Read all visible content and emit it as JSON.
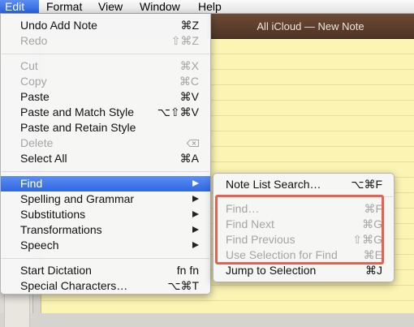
{
  "menubar": {
    "items": [
      {
        "label": "Edit",
        "active": true
      },
      {
        "label": "Format"
      },
      {
        "label": "View"
      },
      {
        "label": "Window"
      },
      {
        "label": "Help"
      }
    ]
  },
  "window": {
    "title": "All iCloud — New Note"
  },
  "edit_menu": {
    "items": [
      {
        "label": "Undo Add Note",
        "shortcut": "⌘Z"
      },
      {
        "label": "Redo",
        "shortcut": "⇧⌘Z",
        "disabled": true
      },
      {
        "label": "Cut",
        "shortcut": "⌘X",
        "disabled": true
      },
      {
        "label": "Copy",
        "shortcut": "⌘C",
        "disabled": true
      },
      {
        "label": "Paste",
        "shortcut": "⌘V"
      },
      {
        "label": "Paste and Match Style",
        "shortcut": "⌥⇧⌘V"
      },
      {
        "label": "Paste and Retain Style",
        "shortcut": ""
      },
      {
        "label": "Delete",
        "shortcut_icon": "delete-key-icon",
        "disabled": true
      },
      {
        "label": "Select All",
        "shortcut": "⌘A"
      },
      {
        "label": "Find",
        "submenu": true,
        "selected": true
      },
      {
        "label": "Spelling and Grammar",
        "submenu": true
      },
      {
        "label": "Substitutions",
        "submenu": true
      },
      {
        "label": "Transformations",
        "submenu": true
      },
      {
        "label": "Speech",
        "submenu": true
      },
      {
        "label": "Start Dictation",
        "shortcut": "fn fn"
      },
      {
        "label": "Special Characters…",
        "shortcut": "⌥⌘T"
      }
    ]
  },
  "find_menu": {
    "items": [
      {
        "label": "Note List Search…",
        "shortcut": "⌥⌘F"
      },
      {
        "label": "Find…",
        "shortcut": "⌘F",
        "disabled": true
      },
      {
        "label": "Find Next",
        "shortcut": "⌘G",
        "disabled": true
      },
      {
        "label": "Find Previous",
        "shortcut": "⇧⌘G",
        "disabled": true
      },
      {
        "label": "Use Selection for Find",
        "shortcut": "⌘E",
        "disabled": true
      },
      {
        "label": "Jump to Selection",
        "shortcut": "⌘J"
      }
    ]
  },
  "colors": {
    "selection": "#3a6ee8",
    "highlight_box": "#e8604f",
    "note_paper": "#fbf4b3",
    "titlebar": "#5e3f2c"
  }
}
